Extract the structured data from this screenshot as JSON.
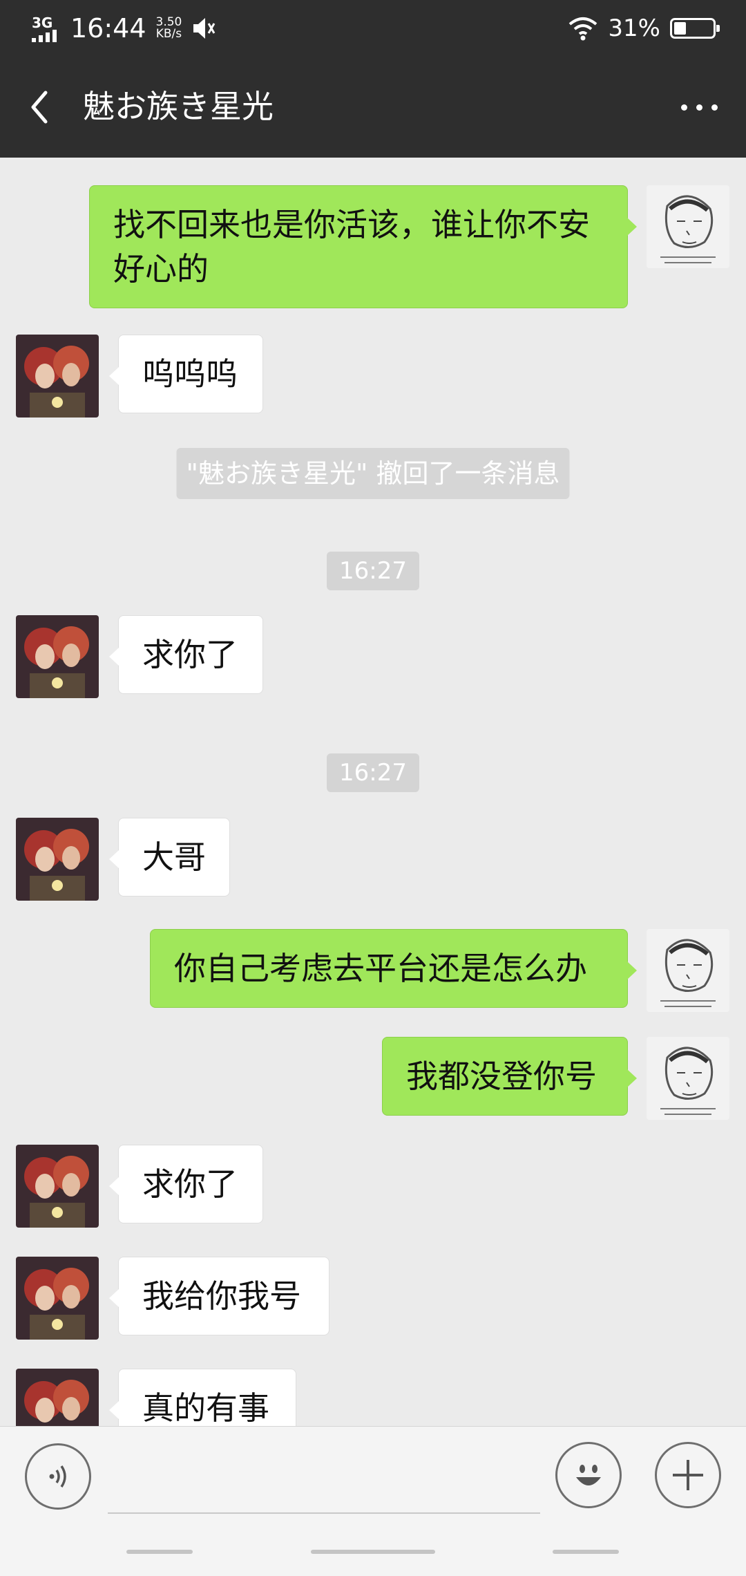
{
  "status_bar": {
    "network": "3G",
    "time": "16:44",
    "speed_value": "3.50",
    "speed_unit": "KB/s",
    "battery_text": "31%",
    "battery_level": 0.31
  },
  "header": {
    "title": "魅お族き星光"
  },
  "messages": [
    {
      "side": "right",
      "text": "找不回来也是你活该，谁让你不安好心的"
    },
    {
      "side": "left",
      "text": "呜呜呜"
    },
    {
      "type": "system",
      "text": "\"魅お族き星光\" 撤回了一条消息"
    },
    {
      "type": "time",
      "text": "16:27"
    },
    {
      "side": "left",
      "text": "求你了"
    },
    {
      "type": "time",
      "text": "16:27"
    },
    {
      "side": "left",
      "text": "大哥"
    },
    {
      "side": "right",
      "text": "你自己考虑去平台还是怎么办"
    },
    {
      "side": "right",
      "text": "我都没登你号"
    },
    {
      "side": "left",
      "text": "求你了"
    },
    {
      "side": "left",
      "text": "我给你我号"
    },
    {
      "side": "left",
      "text": "真的有事"
    }
  ],
  "input_bar": {
    "placeholder": "",
    "voice_icon": "voice-icon",
    "emoji_icon": "emoji-icon",
    "plus_icon": "plus-icon"
  },
  "colors": {
    "header_bg": "#2e2e2e",
    "chat_bg": "#ebebeb",
    "sent_bubble": "#a0e75a",
    "received_bubble": "#ffffff"
  }
}
